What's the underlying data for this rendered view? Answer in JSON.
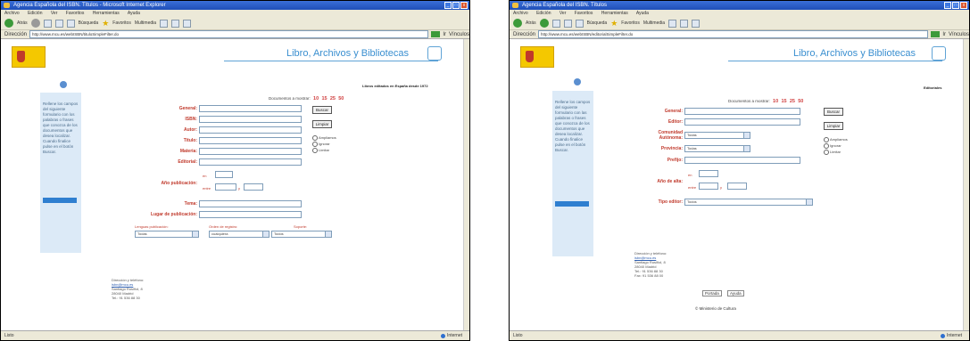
{
  "window1": {
    "title": "Agencia Española del ISBN. Títulos - Microsoft Internet Explorer",
    "menu": [
      "Archivo",
      "Edición",
      "Ver",
      "Favoritos",
      "Herramientas",
      "Ayuda"
    ],
    "toolbar": {
      "back": "Atrás",
      "search": "Búsqueda",
      "favorites": "Favoritos",
      "multimedia": "Multimedia"
    },
    "address_label": "Dirección",
    "url": "http://www.mcu.es/webISBN/tituloSimpleFilter.do",
    "go": "Ir",
    "links": "Vínculos",
    "status": "Listo",
    "zone": "Internet",
    "banner_title": "Libro, Archivos y Bibliotecas",
    "header_right": "Libros editados en España desde 1972",
    "docs_label": "Documentos a mostrar:",
    "docs_options": [
      "10",
      "15",
      "25",
      "50"
    ],
    "side_text": "Rellene los campos del siguiente formulario con los palabras o frases que conozca de los documentos que desea localizar. Cuando finalice pulse en el botón Buscar.",
    "fields": [
      "General:",
      "ISBN:",
      "Autor:",
      "Título:",
      "Materia:",
      "Editorial:",
      "Año publicación:",
      "Tema:",
      "Lugar de publicación:"
    ],
    "year_en": "en",
    "year_entre": "entre",
    "year_y": "y",
    "buttons": {
      "search": "Buscar",
      "clear": "Limpiar"
    },
    "radios": [
      "Ampliamos",
      "Ignorar",
      "Limitar"
    ],
    "bottom_labels": [
      "Lenguas publicación:",
      "Orden de registro:",
      "Soporte:"
    ],
    "bottom_selects": [
      "Todas",
      "cualquiera",
      "Todos"
    ],
    "contact": [
      "Dirección y teléfono:",
      "isbn@mcu.es",
      "Santiago Rusiñol, 8",
      "28040 Madrid",
      "Tel.: 91 536 88 30"
    ]
  },
  "window2": {
    "title": "Agencia Española del ISBN. Títulos",
    "menu": [
      "Archivo",
      "Edición",
      "Ver",
      "Favoritos",
      "Herramientas",
      "Ayuda"
    ],
    "toolbar": {
      "back": "Atrás",
      "search": "Búsqueda",
      "favorites": "Favoritos",
      "multimedia": "Multimedia"
    },
    "address_label": "Dirección",
    "url": "http://www.mcu.es/webISBN/editorialSimpleFilter.do",
    "go": "Ir",
    "links": "Vínculos",
    "status": "Listo",
    "zone": "Internet",
    "banner_title": "Libro, Archivos y Bibliotecas",
    "header_right": "Editoriales",
    "docs_label": "Documentos a mostrar:",
    "docs_options": [
      "10",
      "15",
      "25",
      "50"
    ],
    "side_text": "Rellene los campos del siguiente formulario con las palabras o frases que conozca de los documentos que desea localizar. Cuando finalice pulse en el botón Buscar.",
    "fields": [
      "General:",
      "Editor:",
      "Comunidad Autónoma:",
      "Provincia:",
      "Prefijo:",
      "Año de alta:",
      "Tipo editor:"
    ],
    "selects": {
      "comunidad": "Todas",
      "provincia": "Todas",
      "tipo": "Todos"
    },
    "year_en": "en",
    "year_entre": "entre",
    "year_y": "y",
    "buttons": {
      "search": "Buscar",
      "clear": "Limpiar"
    },
    "radios": [
      "Ampliamos",
      "Ignorar",
      "Limitar"
    ],
    "contact": [
      "Dirección y teléfono:",
      "isbn@mcu.es",
      "Santiago Rusiñol, 8",
      "28040 Madrid",
      "Tel.: 91 536 88 30",
      "Fax: 91 536 88 00"
    ],
    "pager": [
      "Portada",
      "Ayuda"
    ],
    "footer": "© Ministerio de Cultura"
  }
}
